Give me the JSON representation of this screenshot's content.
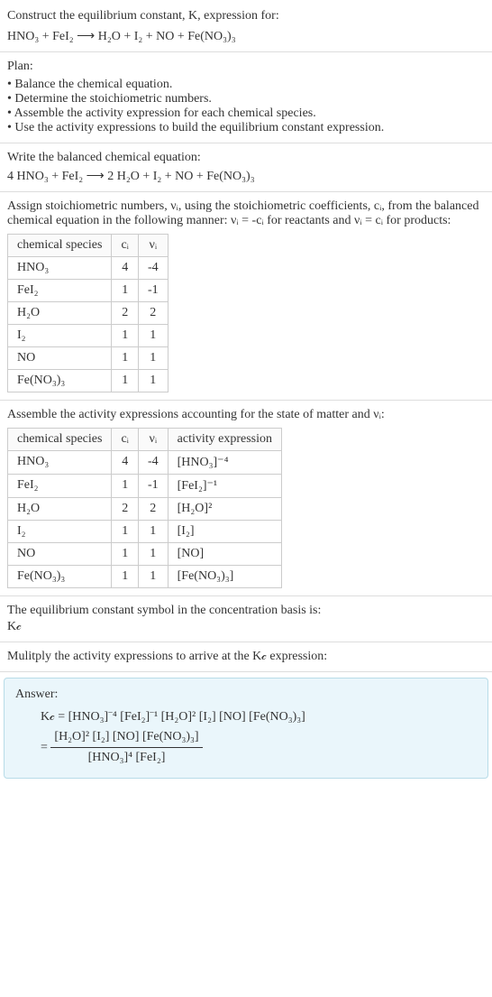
{
  "intro": {
    "line1": "Construct the equilibrium constant, K, expression for:",
    "equation": "HNO₃ + FeI₂ ⟶ H₂O + I₂ + NO + Fe(NO₃)₃"
  },
  "plan": {
    "heading": "Plan:",
    "items": [
      "• Balance the chemical equation.",
      "• Determine the stoichiometric numbers.",
      "• Assemble the activity expression for each chemical species.",
      "• Use the activity expressions to build the equilibrium constant expression."
    ]
  },
  "balanced": {
    "heading": "Write the balanced chemical equation:",
    "equation": "4 HNO₃ + FeI₂ ⟶ 2 H₂O + I₂ + NO + Fe(NO₃)₃"
  },
  "stoich": {
    "heading": "Assign stoichiometric numbers, νᵢ, using the stoichiometric coefficients, cᵢ, from the balanced chemical equation in the following manner: νᵢ = -cᵢ for reactants and νᵢ = cᵢ for products:",
    "cols": [
      "chemical species",
      "cᵢ",
      "νᵢ"
    ],
    "rows": [
      {
        "species": "HNO₃",
        "c": "4",
        "v": "-4"
      },
      {
        "species": "FeI₂",
        "c": "1",
        "v": "-1"
      },
      {
        "species": "H₂O",
        "c": "2",
        "v": "2"
      },
      {
        "species": "I₂",
        "c": "1",
        "v": "1"
      },
      {
        "species": "NO",
        "c": "1",
        "v": "1"
      },
      {
        "species": "Fe(NO₃)₃",
        "c": "1",
        "v": "1"
      }
    ]
  },
  "activity": {
    "heading": "Assemble the activity expressions accounting for the state of matter and νᵢ:",
    "cols": [
      "chemical species",
      "cᵢ",
      "νᵢ",
      "activity expression"
    ],
    "rows": [
      {
        "species": "HNO₃",
        "c": "4",
        "v": "-4",
        "expr": "[HNO₃]⁻⁴"
      },
      {
        "species": "FeI₂",
        "c": "1",
        "v": "-1",
        "expr": "[FeI₂]⁻¹"
      },
      {
        "species": "H₂O",
        "c": "2",
        "v": "2",
        "expr": "[H₂O]²"
      },
      {
        "species": "I₂",
        "c": "1",
        "v": "1",
        "expr": "[I₂]"
      },
      {
        "species": "NO",
        "c": "1",
        "v": "1",
        "expr": "[NO]"
      },
      {
        "species": "Fe(NO₃)₃",
        "c": "1",
        "v": "1",
        "expr": "[Fe(NO₃)₃]"
      }
    ]
  },
  "symbol": {
    "heading": "The equilibrium constant symbol in the concentration basis is:",
    "value": "K𝒸"
  },
  "multiply": {
    "heading": "Mulitply the activity expressions to arrive at the K𝒸 expression:"
  },
  "answer": {
    "label": "Answer:",
    "line1": "K𝒸 = [HNO₃]⁻⁴ [FeI₂]⁻¹ [H₂O]² [I₂] [NO] [Fe(NO₃)₃]",
    "eq": "=",
    "num": "[H₂O]² [I₂] [NO] [Fe(NO₃)₃]",
    "den": "[HNO₃]⁴ [FeI₂]"
  },
  "chart_data": {
    "type": "table",
    "tables": [
      {
        "title": "Stoichiometric numbers",
        "columns": [
          "chemical species",
          "c_i",
          "v_i"
        ],
        "rows": [
          [
            "HNO3",
            4,
            -4
          ],
          [
            "FeI2",
            1,
            -1
          ],
          [
            "H2O",
            2,
            2
          ],
          [
            "I2",
            1,
            1
          ],
          [
            "NO",
            1,
            1
          ],
          [
            "Fe(NO3)3",
            1,
            1
          ]
        ]
      },
      {
        "title": "Activity expressions",
        "columns": [
          "chemical species",
          "c_i",
          "v_i",
          "activity expression"
        ],
        "rows": [
          [
            "HNO3",
            4,
            -4,
            "[HNO3]^-4"
          ],
          [
            "FeI2",
            1,
            -1,
            "[FeI2]^-1"
          ],
          [
            "H2O",
            2,
            2,
            "[H2O]^2"
          ],
          [
            "I2",
            1,
            1,
            "[I2]"
          ],
          [
            "NO",
            1,
            1,
            "[NO]"
          ],
          [
            "Fe(NO3)3",
            1,
            1,
            "[Fe(NO3)3]"
          ]
        ]
      }
    ]
  }
}
